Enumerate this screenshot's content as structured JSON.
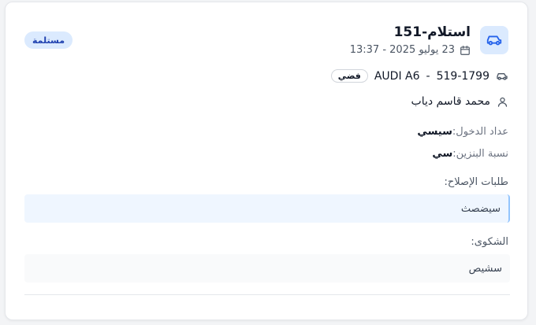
{
  "card": {
    "title": "استلام-151",
    "date": "23 يوليو 2025 - 13:37",
    "status": "مستلمة",
    "vehicle": {
      "plate": "519-1799",
      "separator": "-",
      "model": "AUDI A6",
      "color": "فضي"
    },
    "owner": "محمد قاسم دياب",
    "odometer": {
      "label": "عداد الدخول:",
      "value": "سيسي"
    },
    "fuel": {
      "label": "نسبة البنزين:",
      "value": "سي"
    },
    "repairs": {
      "label": "طلبات الإصلاح:",
      "value": "سيضصث"
    },
    "complaints": {
      "label": "الشكوى:",
      "value": "سشيص"
    }
  },
  "icons": {
    "badge": "car-icon",
    "date": "calendar-icon",
    "vehicle": "car-icon",
    "owner": "user-icon"
  },
  "colors": {
    "accent": "#2563eb",
    "badge_bg": "#dbeafe",
    "status_text": "#1e40af"
  }
}
